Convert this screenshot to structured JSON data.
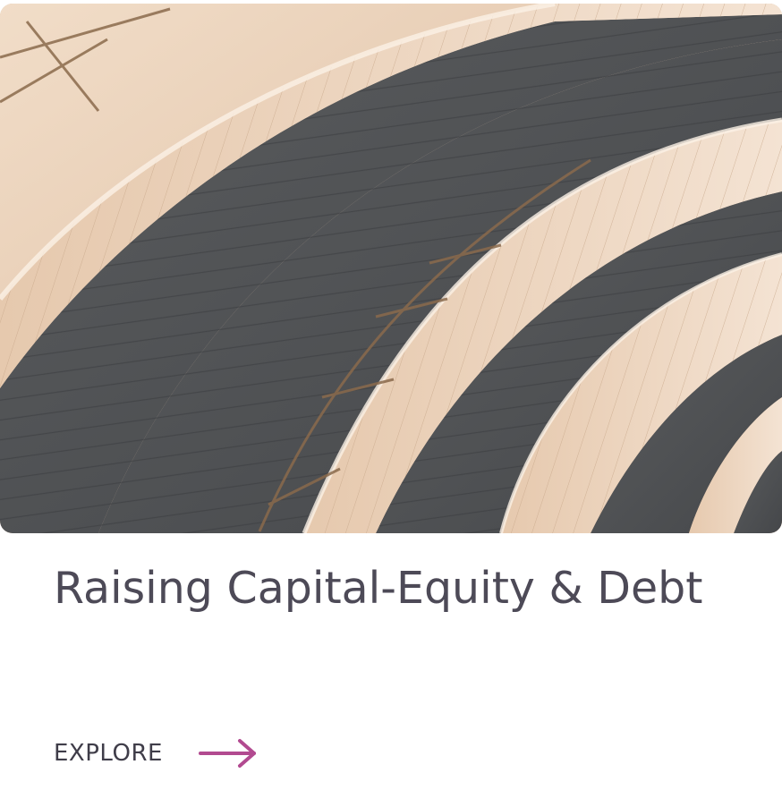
{
  "card": {
    "title": "Raising Capital-Equity & Debt",
    "cta_label": "EXPLORE",
    "cta_icon": "arrow-right-icon",
    "hero_image": "arched-roof-architecture-image"
  },
  "colors": {
    "title": "#4d4a57",
    "cta_text": "#3f3d49",
    "cta_arrow": "#b24a90",
    "arch_cream": "#e9d2bd",
    "roof_dark": "#4f5253"
  }
}
